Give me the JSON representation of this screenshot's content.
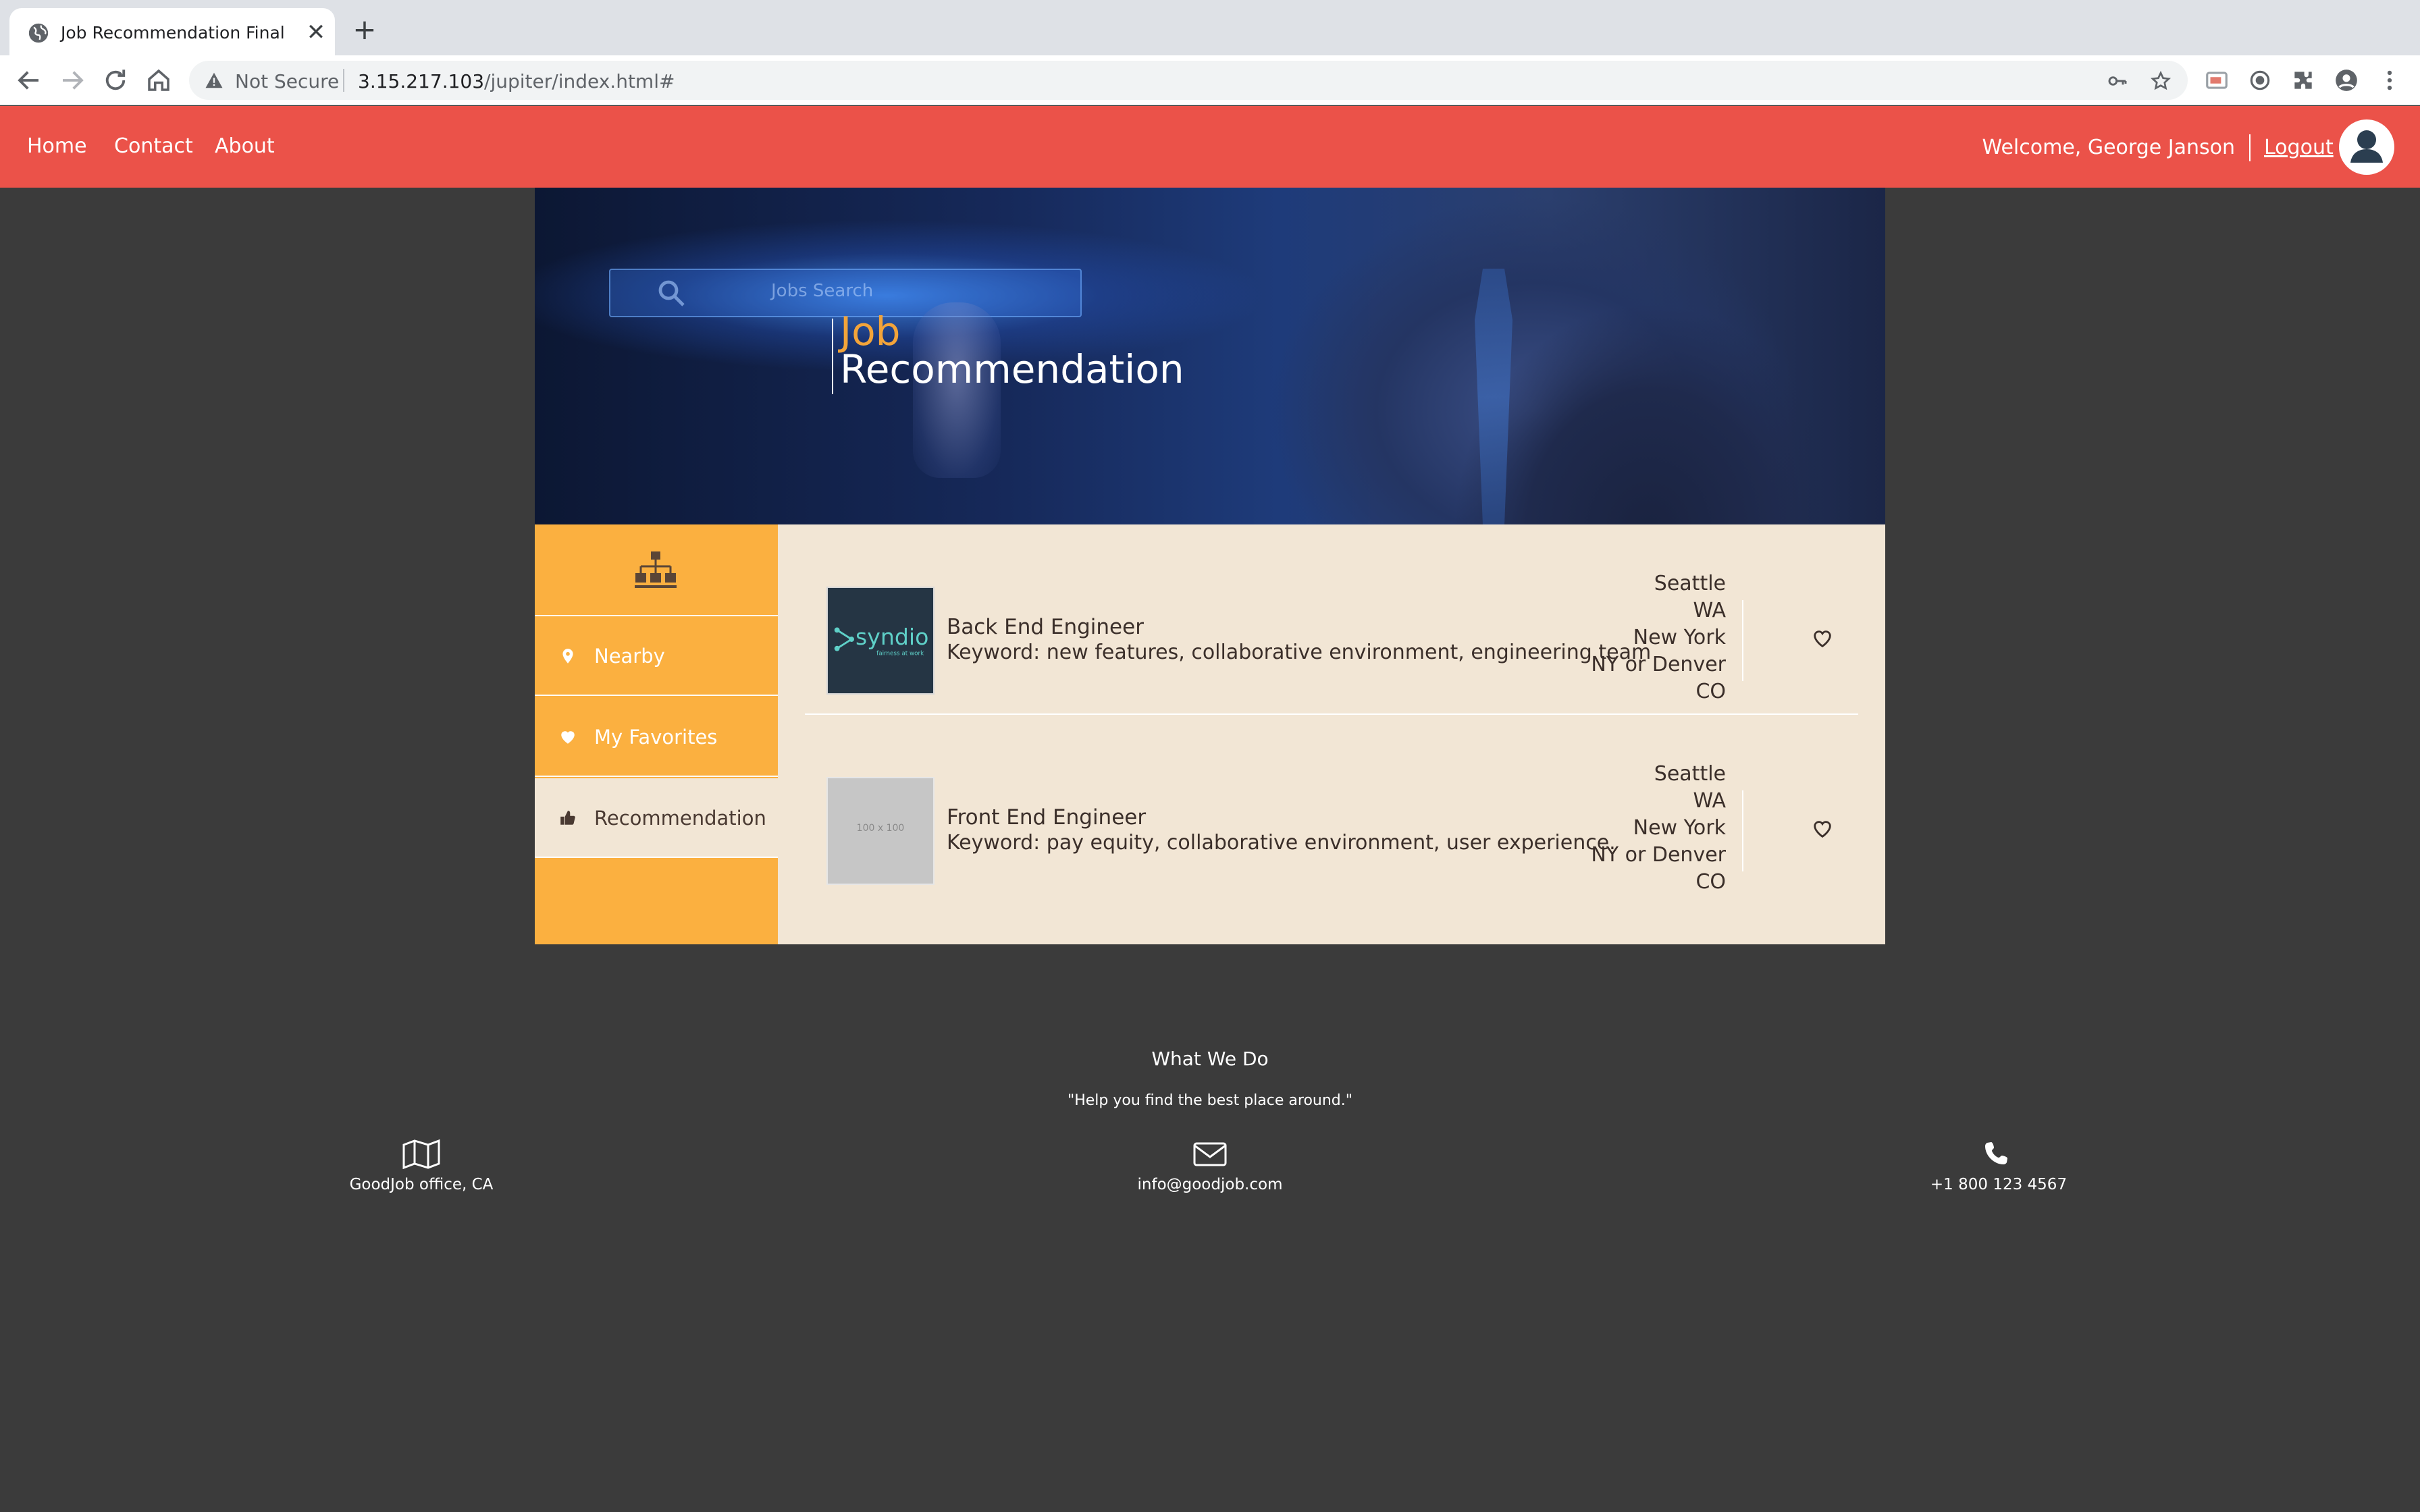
{
  "browser": {
    "tab_title": "Job Recommendation Final",
    "security_label": "Not Secure",
    "url_host": "3.15.217.103",
    "url_path": "/jupiter/index.html#"
  },
  "header": {
    "nav": [
      "Home",
      "Contact",
      "About"
    ],
    "welcome": "Welcome, George Janson",
    "logout": "Logout",
    "accent_color": "#eb5249"
  },
  "hero": {
    "search_text": "Jobs Search",
    "title_line1": "Job",
    "title_line2": "Recommendation",
    "title_accent_color": "#f3a43a"
  },
  "sidebar": {
    "top_icon": "sitemap-icon",
    "items": [
      {
        "label": "Nearby",
        "icon": "map-marker-icon",
        "active": false
      },
      {
        "label": "My Favorites",
        "icon": "heart-icon",
        "active": false
      },
      {
        "label": "Recommendation",
        "icon": "thumbs-up-icon",
        "active": true
      }
    ],
    "color": "#fbb040"
  },
  "jobs": [
    {
      "logo_text": "syndio",
      "logo_subtext": "fairness at work",
      "title": "Back End Engineer",
      "keywords": "Keyword: new features, collaborative environment, engineering team",
      "location": [
        "Seattle",
        "WA",
        "New York",
        "NY or Denver",
        "CO"
      ],
      "favorite_icon": "heart-outline-icon"
    },
    {
      "logo_text": "100 x 100",
      "title": "Front End Engineer",
      "keywords": "Keyword: pay equity, collaborative environment, user experience.",
      "location": [
        "Seattle",
        "WA",
        "New York",
        "NY or Denver",
        "CO"
      ],
      "favorite_icon": "heart-outline-icon"
    }
  ],
  "footer": {
    "heading": "What We Do",
    "quote": "\"Help you find the best place around.\"",
    "contacts": [
      {
        "icon": "map-icon",
        "text": "GoodJob office, CA"
      },
      {
        "icon": "envelope-icon",
        "text": "info@goodjob.com"
      },
      {
        "icon": "phone-icon",
        "text": "+1 800 123 4567"
      }
    ]
  }
}
